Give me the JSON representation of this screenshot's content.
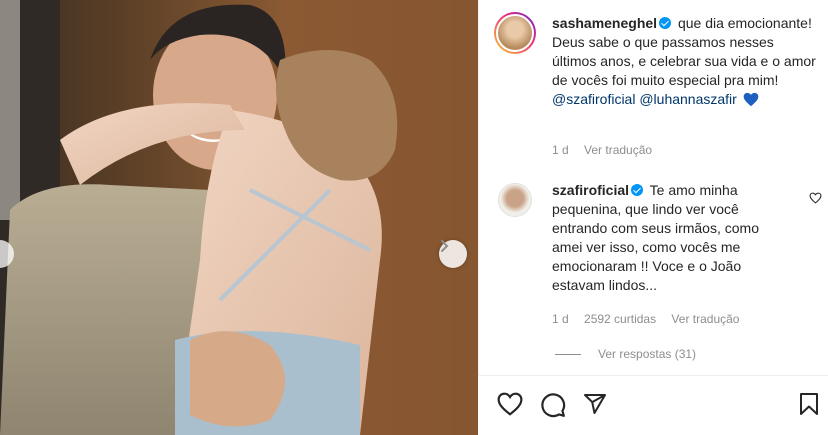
{
  "post": {
    "author": "sashameneghel",
    "caption": "que dia emocionante! Deus sabe o que passamos nesses últimos anos, e celebrar sua vida e o amor de vocês foi muito especial pra mim!",
    "mention_1": "@szafiroficial",
    "mention_2": "@luhannaszafir",
    "age": "1 d",
    "translate": "Ver tradução"
  },
  "comment": {
    "author": "szafiroficial",
    "text": "Te amo minha pequenina, que lindo ver você entrando com seus irmãos, como amei ver isso, como vocês me emocionaram !! Voce e o João estavam lindos...",
    "age": "1 d",
    "likes": "2592 curtidas",
    "translate": "Ver tradução",
    "replies": "Ver respostas (31)"
  },
  "icons": {
    "verified": "verified-badge-icon",
    "heart": "heart-icon",
    "comment": "comment-icon",
    "share": "share-icon",
    "save": "bookmark-icon",
    "next": "chevron-right-icon"
  },
  "colors": {
    "verified": "#0095f6",
    "mention": "#00376b",
    "muted": "#8e8e8e",
    "text": "#262626"
  }
}
